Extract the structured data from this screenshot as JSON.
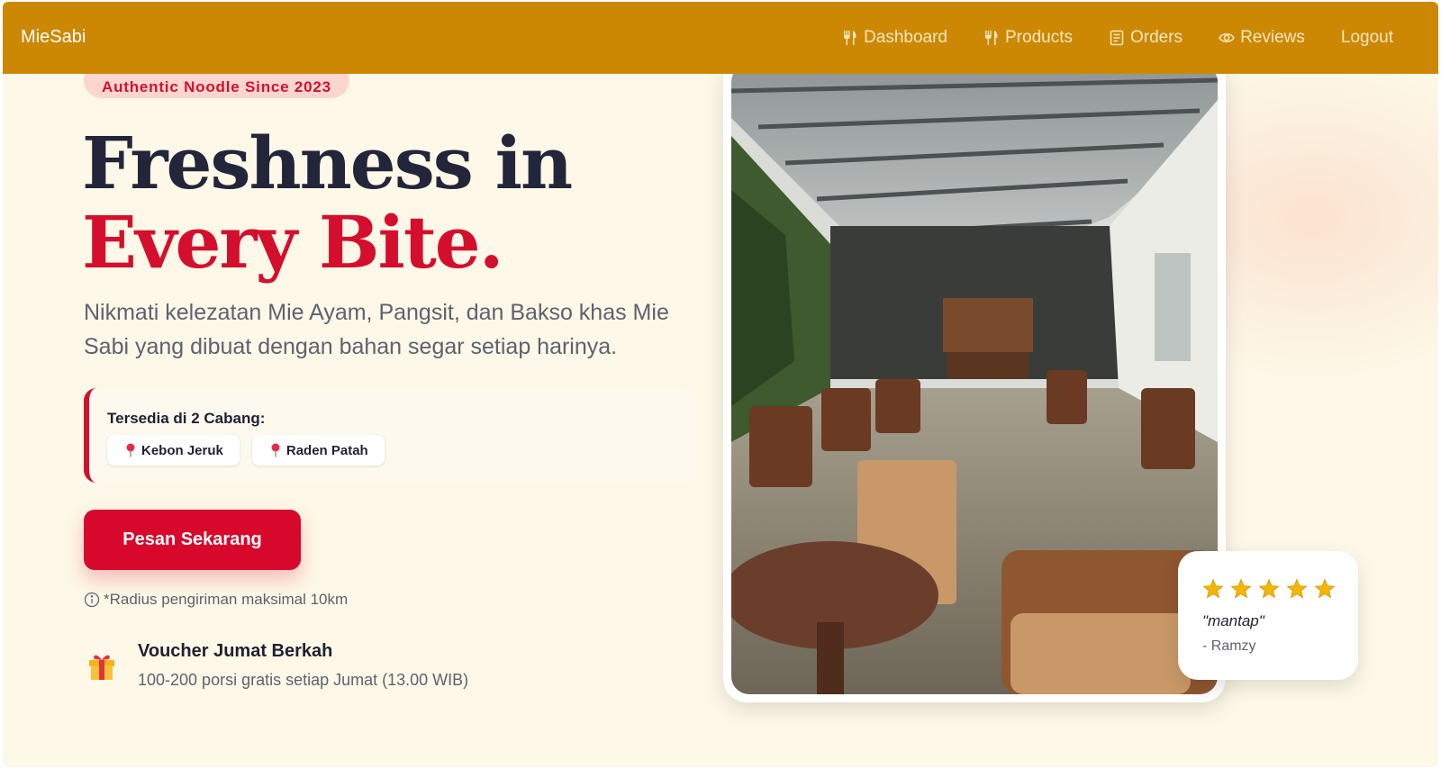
{
  "navbar": {
    "brand": "MieSabi",
    "links": [
      {
        "label": "Dashboard",
        "icon": "fork-knife-icon"
      },
      {
        "label": "Products",
        "icon": "fork-knife-icon"
      },
      {
        "label": "Orders",
        "icon": "receipt-icon"
      },
      {
        "label": "Reviews",
        "icon": "eye-icon"
      },
      {
        "label": "Logout",
        "icon": ""
      }
    ],
    "color": "#cc8802"
  },
  "hero": {
    "badge": "Authentic Noodle Since 2023",
    "title_line1": "Freshness in",
    "title_line2": "Every Bite.",
    "description": "Nikmati kelezatan Mie Ayam, Pangsit, dan Bakso khas Mie Sabi yang dibuat dengan bahan segar setiap harinya.",
    "branches_label": "Tersedia di 2 Cabang:",
    "branches": [
      "Kebon Jeruk",
      "Raden Patah"
    ],
    "cta_label": "Pesan Sekarang",
    "note": "*Radius pengiriman maksimal 10km",
    "voucher_title": "Voucher Jumat Berkah",
    "voucher_subtitle": "100-200 porsi gratis setiap Jumat (13.00 WIB)"
  },
  "review": {
    "rating": 5,
    "quote": "\"mantap\"",
    "author": "- Ramzy"
  },
  "colors": {
    "accent_red": "#d40f2d",
    "background": "#fdf8e7",
    "navbar": "#cc8802",
    "star": "#f2b705"
  }
}
